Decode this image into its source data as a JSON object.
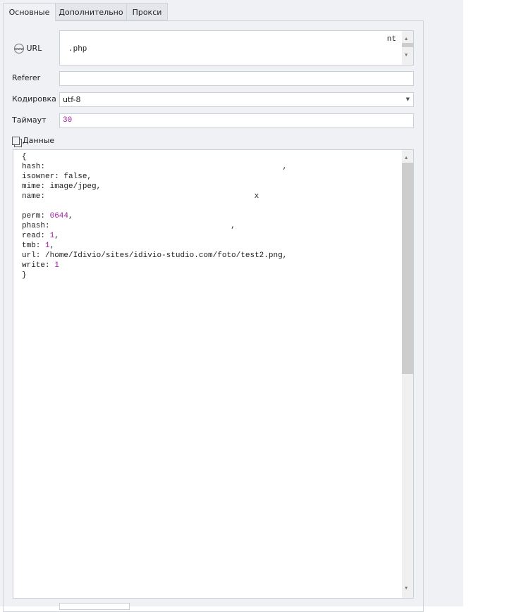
{
  "tabs": [
    {
      "label": "Основные"
    },
    {
      "label": "Дополнительно"
    },
    {
      "label": "Прокси"
    }
  ],
  "url": {
    "label": "URL",
    "icon": "www-icon",
    "value_line1": "nt",
    "value_line2": ".php"
  },
  "referer": {
    "label": "Referer",
    "value": ""
  },
  "encoding": {
    "label": "Кодировка",
    "value": "utf-8"
  },
  "timeout": {
    "label": "Таймаут",
    "value": "30"
  },
  "data": {
    "label": "Данные",
    "lines": [
      {
        "k": "{",
        "v": "",
        "num": false
      },
      {
        "k": "hash: ",
        "v": ",",
        "num": false
      },
      {
        "k": "isowner: ",
        "v": "false,",
        "num": false
      },
      {
        "k": "mime: ",
        "v": "image/jpeg,",
        "num": false
      },
      {
        "k": "name: ",
        "v": "x",
        "num": false
      },
      {
        "k": "",
        "v": "",
        "num": false
      },
      {
        "k": "perm: ",
        "v": "0644",
        "num": true
      },
      {
        "k": "phash: ",
        "v": ",",
        "num": false
      },
      {
        "k": "read: ",
        "v": "1",
        "num": true
      },
      {
        "k": "tmb: ",
        "v": "1",
        "num": true
      },
      {
        "k": "url: ",
        "v": "/home/Idivio/sites/idivio-studio.com/foto/test2.png,",
        "num": false
      },
      {
        "k": "write: ",
        "v": "1",
        "num": true
      },
      {
        "k": "}",
        "v": "",
        "num": false
      }
    ]
  }
}
